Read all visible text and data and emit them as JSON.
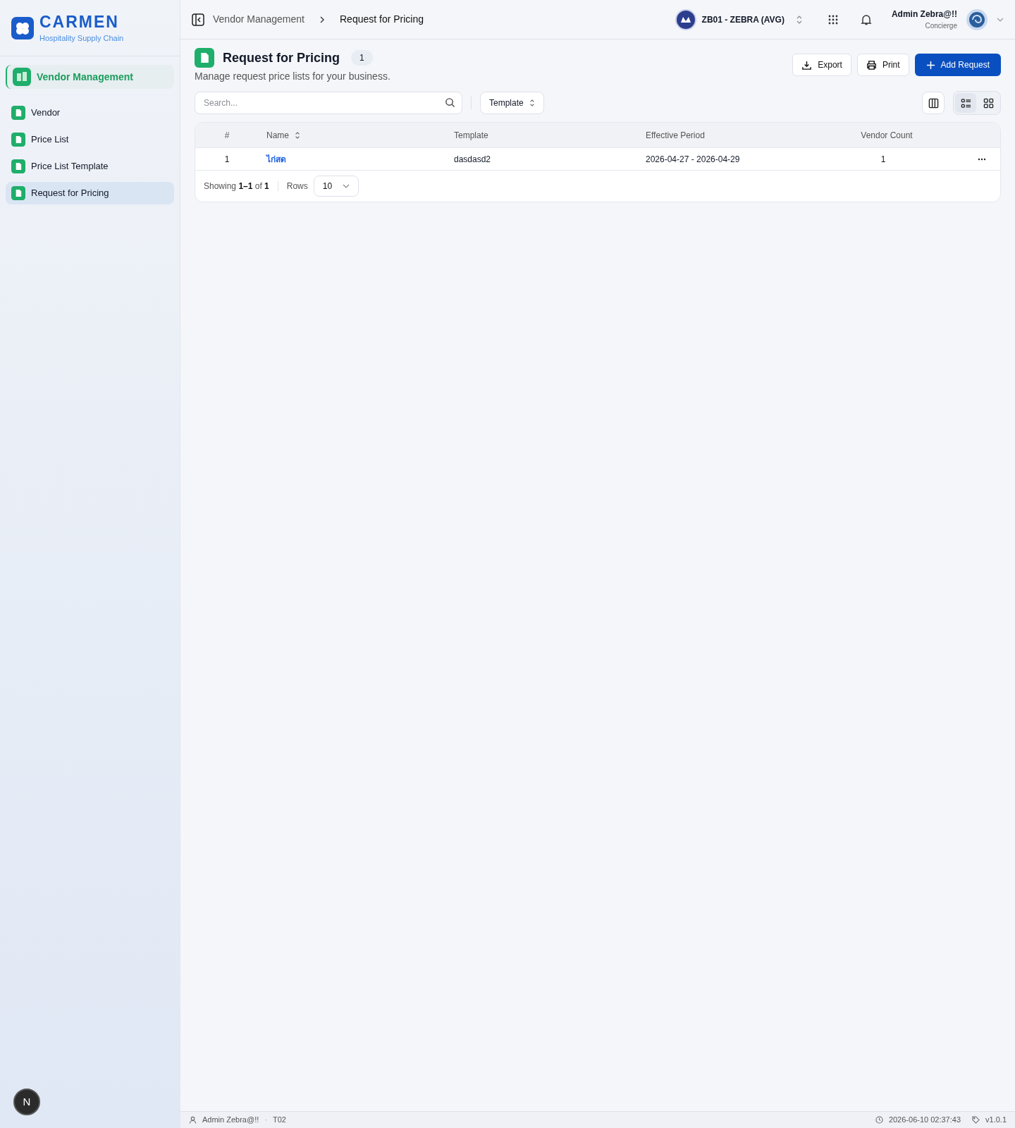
{
  "brand": {
    "name": "CARMEN",
    "tagline": "Hospitality Supply Chain"
  },
  "sidebar": {
    "section": {
      "label": "Vendor Management",
      "selected": true
    },
    "items": [
      {
        "label": "Vendor",
        "selected": false
      },
      {
        "label": "Price List",
        "selected": false
      },
      {
        "label": "Price List Template",
        "selected": false
      },
      {
        "label": "Request for Pricing",
        "selected": true
      }
    ]
  },
  "breadcrumbs": [
    "Vendor Management",
    "Request for Pricing"
  ],
  "org": {
    "label": "ZB01 - ZEBRA (AVG)"
  },
  "user": {
    "name": "Admin Zebra@!!",
    "role": "Concierge"
  },
  "page": {
    "title": "Request for Pricing",
    "count": "1",
    "subtitle": "Manage request price lists for your business."
  },
  "actions": [
    {
      "label": "Export",
      "kind": "export"
    },
    {
      "label": "Print",
      "kind": "print"
    },
    {
      "label": "Add Request",
      "kind": "add"
    }
  ],
  "search": {
    "placeholder": "Search..."
  },
  "filter": {
    "label": "Template"
  },
  "views": [
    {
      "kind": "list",
      "selected": true
    },
    {
      "kind": "grid",
      "selected": false
    }
  ],
  "table": {
    "columns": [
      {
        "label": "#",
        "sortable": false
      },
      {
        "label": "Name",
        "sortable": true
      },
      {
        "label": "Template",
        "sortable": false
      },
      {
        "label": "Effective Period",
        "sortable": false
      },
      {
        "label": "Vendor Count",
        "sortable": false
      }
    ],
    "rows": [
      {
        "cells": [
          "1",
          "ไก่สด",
          "dasdasd2",
          "2026-04-27 - 2026-04-29",
          "1"
        ]
      }
    ]
  },
  "pagination": {
    "showing_label": "Showing",
    "range": "1–1",
    "of_label": "of",
    "total": "1",
    "rows_label": "Rows",
    "rows_value": "10"
  },
  "dev_badge": "N",
  "status_bar": {
    "user": "Admin Zebra@!!",
    "separator": "·",
    "code": "T02",
    "datetime": "2026-06-10 02:37:43",
    "version": "v1.0.1"
  }
}
